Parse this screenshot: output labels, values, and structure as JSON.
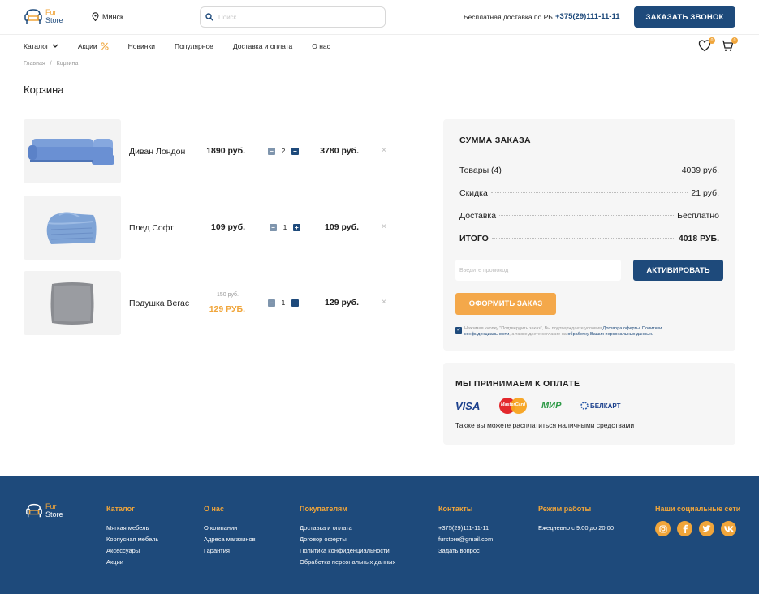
{
  "header": {
    "logo_line1": "Fur",
    "logo_line2": "Store",
    "city": "Минск",
    "search_placeholder": "Поиск",
    "delivery_note": "Бесплатная доставка по РБ",
    "phone": "+375(29)111-11-11",
    "callback_label": "Заказать звонок",
    "favorites_count": "0",
    "cart_count": "0"
  },
  "nav": {
    "catalog": "Каталог",
    "promo": "Акции",
    "new": "Новинки",
    "popular": "Популярное",
    "delivery": "Доставка и оплата",
    "about": "О нас"
  },
  "breadcrumb": {
    "home": "Главная",
    "sep": "/",
    "current": "Корзина"
  },
  "page_title": "Корзина",
  "cart": {
    "items": [
      {
        "name": "Диван Лондон",
        "price": "1890 руб.",
        "qty": "2",
        "sum": "3780 руб.",
        "image": "sofa"
      },
      {
        "name": "Плед Софт",
        "price": "109 руб.",
        "qty": "1",
        "sum": "109 руб.",
        "image": "blanket"
      },
      {
        "name": "Подушка Вегас",
        "price_old": "150 руб.",
        "price": "129 РУБ.",
        "qty": "1",
        "sum": "129 руб.",
        "image": "pillow"
      }
    ],
    "remove_icon": "×",
    "minus_icon": "−",
    "plus_icon": "+"
  },
  "summary": {
    "title": "Сумма заказа",
    "goods_label": "Товары (4)",
    "goods_value": "4039 руб.",
    "discount_label": "Скидка",
    "discount_value": "21 руб.",
    "delivery_label": "Доставка",
    "delivery_value": "Бесплатно",
    "total_label": "ИТОГО",
    "total_value": "4018 РУБ.",
    "promo_placeholder": "Введите промокод",
    "activate_label": "Активировать",
    "order_label": "Оформить заказ",
    "consent_text": "Нажимая кнопку \"Подтвердить заказ\", Вы подтверждаете условия",
    "consent_link1": "Договора оферты, Политики конфиденциальности",
    "consent_mid": ", а также даете согласие на",
    "consent_link2": "обработку Ваших персональных данных."
  },
  "payment": {
    "title": "Мы принимаем к оплате",
    "visa": "VISA",
    "mastercard": "MasterCard",
    "mir": "МИР",
    "belkart": "БЕЛКАРТ",
    "note": "Также вы можете расплатиться наличными средствами"
  },
  "footer": {
    "logo_line1": "Fur",
    "logo_line2": "Store",
    "catalog_title": "Каталог",
    "catalog_links": [
      "Мягкая мебель",
      "Корпусная мебель",
      "Аксессуары",
      "Акции"
    ],
    "about_title": "О нас",
    "about_links": [
      "О компании",
      "Адреса магазинов",
      "Гарантия"
    ],
    "buyers_title": "Покупателям",
    "buyers_links": [
      "Доставка и оплата",
      "Договор оферты",
      "Политика конфиденциальности",
      "Обработка персональных данных"
    ],
    "contacts_title": "Контакты",
    "contacts_links": [
      "+375(29)111-11-11",
      "furstore@gmail.com",
      "Задать вопрос"
    ],
    "hours_title": "Режим работы",
    "hours_text": "Ежедневно с 9:00 до 20:00",
    "social_title": "Наши социальные сети"
  },
  "colors": {
    "primary": "#1e4a7b",
    "accent": "#f0a53a"
  }
}
